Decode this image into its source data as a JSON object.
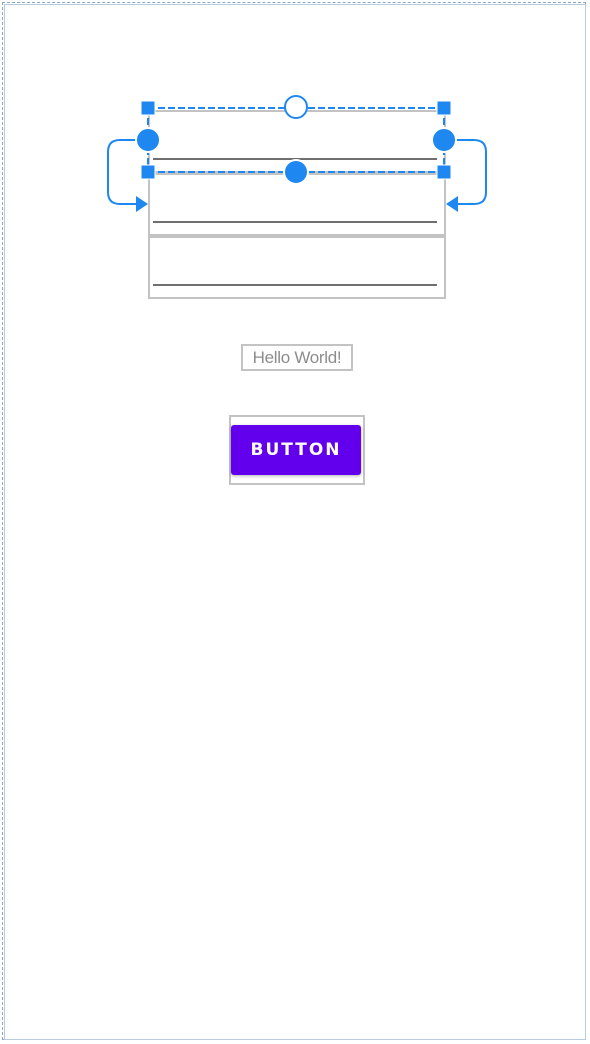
{
  "canvas": {
    "background": "#ffffff",
    "frame_color": "#8aa8c6",
    "selection_color": "#1e88f0"
  },
  "widgets": {
    "edit_text_1": {
      "value": ""
    },
    "edit_text_2": {
      "value": ""
    },
    "edit_text_3": {
      "value": ""
    },
    "text_view": {
      "text": "Hello World!"
    },
    "button": {
      "label": "BUTTON",
      "color": "#6200ee"
    }
  },
  "selection": {
    "target": "edit_text_1",
    "icons": [
      "resize-handle-icon",
      "constraint-anchor-icon",
      "constraint-arrow-icon"
    ]
  }
}
